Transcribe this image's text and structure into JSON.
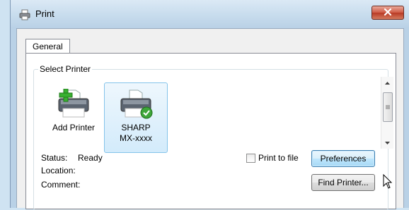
{
  "window": {
    "title": "Print"
  },
  "tabs": [
    {
      "label": "General"
    }
  ],
  "select_printer": {
    "group_label": "Select Printer",
    "printers": [
      {
        "label": "Add Printer",
        "icon": "add-printer-icon"
      },
      {
        "label": "SHARP\nMX-xxxx",
        "icon": "printer-default-icon",
        "selected": true
      }
    ]
  },
  "details": {
    "status_label": "Status:",
    "status_value": "Ready",
    "location_label": "Location:",
    "location_value": "",
    "comment_label": "Comment:",
    "comment_value": ""
  },
  "print_to_file": {
    "label": "Print to file",
    "checked": false
  },
  "buttons": {
    "preferences": "Preferences",
    "find_printer": "Find Printer..."
  },
  "colors": {
    "close_button": "#c9483a",
    "selection": "#d3ebfb",
    "accent": "#3c7fb1"
  }
}
